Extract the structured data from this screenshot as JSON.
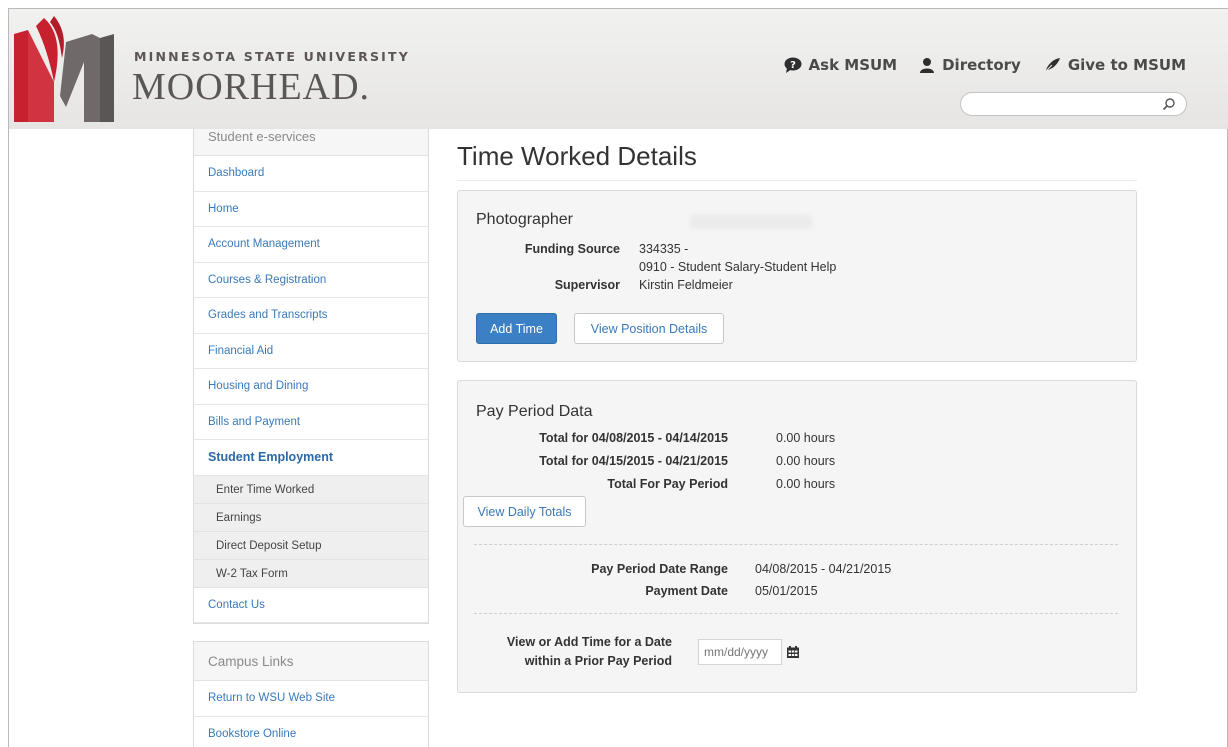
{
  "header": {
    "logo_top": "MINNESOTA STATE UNIVERSITY",
    "logo_main": "MOORHEAD.",
    "links": [
      {
        "label": "Ask MSUM",
        "icon": "chat-question-icon"
      },
      {
        "label": "Directory",
        "icon": "person-icon"
      },
      {
        "label": "Give to MSUM",
        "icon": "feather-icon"
      }
    ],
    "search": {
      "value": "",
      "placeholder": ""
    }
  },
  "colors": {
    "brand_red": "#c7202f",
    "brand_gray": "#5a5655",
    "link_blue": "#3a79b8",
    "button_primary": "#3b80c4"
  },
  "sidebar": {
    "heading": "Student e-services",
    "items": [
      {
        "label": "Dashboard"
      },
      {
        "label": "Home"
      },
      {
        "label": "Account Management"
      },
      {
        "label": "Courses & Registration"
      },
      {
        "label": "Grades and Transcripts"
      },
      {
        "label": "Financial Aid"
      },
      {
        "label": "Housing and Dining"
      },
      {
        "label": "Bills and Payment"
      },
      {
        "label": "Student Employment"
      }
    ],
    "sub_items": [
      {
        "label": "Enter Time Worked"
      },
      {
        "label": "Earnings"
      },
      {
        "label": "Direct Deposit Setup"
      },
      {
        "label": "W-2 Tax Form"
      }
    ],
    "after_item": {
      "label": "Contact Us"
    },
    "campus_heading": "Campus Links",
    "campus_items": [
      {
        "label": "Return to WSU Web Site"
      },
      {
        "label": "Bookstore Online"
      }
    ]
  },
  "main": {
    "title": "Time Worked Details",
    "position": {
      "title": "Photographer",
      "funding_label": "Funding Source",
      "funding_value_1": "334335 -",
      "funding_value_2": "0910 - Student Salary-Student Help",
      "supervisor_label": "Supervisor",
      "supervisor_value": "Kirstin Feldmeier",
      "add_time_label": "Add Time",
      "view_details_label": "View Position Details"
    },
    "pay_period": {
      "title": "Pay Period Data",
      "rows": [
        {
          "label": "Total for 04/08/2015 - 04/14/2015",
          "value": "0.00 hours"
        },
        {
          "label": "Total for 04/15/2015 - 04/21/2015",
          "value": "0.00 hours"
        },
        {
          "label": "Total For Pay Period",
          "value": "0.00 hours"
        }
      ],
      "daily_totals_label": "View Daily Totals",
      "date_range_label": "Pay Period Date Range",
      "date_range_value": "04/08/2015 - 04/21/2015",
      "payment_date_label": "Payment Date",
      "payment_date_value": "05/01/2015",
      "prior_label_1": "View or Add Time for a Date",
      "prior_label_2": "within a Prior Pay Period",
      "date_placeholder": "mm/dd/yyyy"
    }
  }
}
